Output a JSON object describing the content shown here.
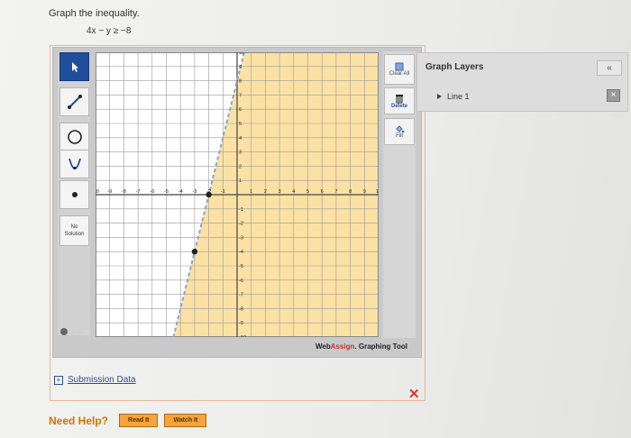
{
  "question": {
    "title": "Graph the inequality.",
    "inequality": "4x − y ≥ −8"
  },
  "tools": {
    "items": [
      {
        "name": "pointer",
        "icon": "arrow-pointer-icon",
        "active": true
      },
      {
        "name": "line",
        "icon": "line-segment-icon",
        "active": false
      },
      {
        "name": "circle",
        "icon": "circle-icon",
        "active": false
      },
      {
        "name": "parabola",
        "icon": "parabola-icon",
        "active": false
      },
      {
        "name": "point",
        "icon": "point-icon",
        "active": false
      }
    ],
    "no_solution_line1": "No",
    "no_solution_line2": "Solution",
    "help_label": "Help"
  },
  "actions": {
    "clear_all": "Clear All",
    "delete": "Delete",
    "fill": "Fill"
  },
  "brand": {
    "prefix": "Web",
    "accent": "Assign",
    "suffix": ". Graphing Tool"
  },
  "layers": {
    "header": "Graph Layers",
    "collapse_icon": "«",
    "items": [
      {
        "label": "Line 1"
      }
    ]
  },
  "submission": {
    "toggle": "+",
    "label": "Submission Data"
  },
  "help": {
    "label": "Need Help?",
    "read_it": "Read It",
    "watch_it": "Watch It"
  },
  "colors": {
    "shade": "#fbe2a4",
    "line": "#8aa4cf",
    "accent_blue": "#1f4e9c",
    "brand_red": "#c0392b",
    "help_orange": "#d07400"
  },
  "graph": {
    "xlim": [
      -10,
      10
    ],
    "ylim": [
      -10,
      10
    ],
    "grid_step": 1,
    "boundary": {
      "slope": 4,
      "intercept": 8,
      "style": "dashed"
    },
    "shaded_side": "right",
    "points": [
      [
        -2,
        0
      ],
      [
        -3,
        -4
      ]
    ],
    "x_ticks": [
      "-10",
      "-9",
      "-8",
      "-7",
      "-6",
      "-5",
      "-4",
      "-3",
      "-2",
      "-1",
      "1",
      "2",
      "3",
      "4",
      "5",
      "6",
      "7",
      "8",
      "9",
      "10"
    ],
    "y_ticks_pos": [
      "10",
      "9",
      "8",
      "7",
      "6",
      "5",
      "4",
      "3",
      "2",
      "1"
    ],
    "y_ticks_neg": [
      "-1",
      "-2",
      "-3",
      "-4",
      "-5",
      "-6",
      "-7",
      "-8",
      "-9",
      "-10"
    ]
  }
}
